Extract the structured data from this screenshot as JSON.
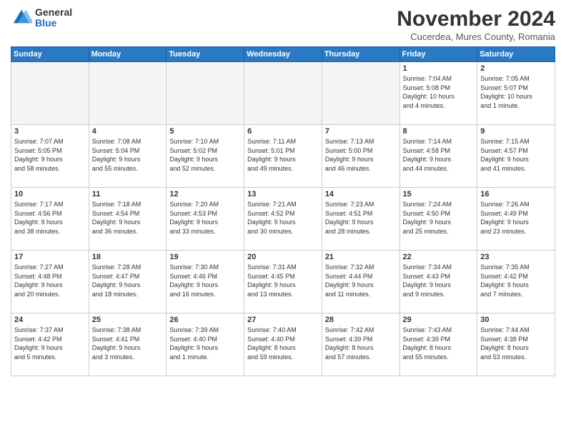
{
  "logo": {
    "general": "General",
    "blue": "Blue"
  },
  "header": {
    "title": "November 2024",
    "subtitle": "Cucerdea, Mures County, Romania"
  },
  "weekdays": [
    "Sunday",
    "Monday",
    "Tuesday",
    "Wednesday",
    "Thursday",
    "Friday",
    "Saturday"
  ],
  "rows": [
    [
      {
        "day": "",
        "info": "",
        "empty": true
      },
      {
        "day": "",
        "info": "",
        "empty": true
      },
      {
        "day": "",
        "info": "",
        "empty": true
      },
      {
        "day": "",
        "info": "",
        "empty": true
      },
      {
        "day": "",
        "info": "",
        "empty": true
      },
      {
        "day": "1",
        "info": "Sunrise: 7:04 AM\nSunset: 5:08 PM\nDaylight: 10 hours\nand 4 minutes.",
        "empty": false
      },
      {
        "day": "2",
        "info": "Sunrise: 7:05 AM\nSunset: 5:07 PM\nDaylight: 10 hours\nand 1 minute.",
        "empty": false
      }
    ],
    [
      {
        "day": "3",
        "info": "Sunrise: 7:07 AM\nSunset: 5:05 PM\nDaylight: 9 hours\nand 58 minutes.",
        "empty": false
      },
      {
        "day": "4",
        "info": "Sunrise: 7:08 AM\nSunset: 5:04 PM\nDaylight: 9 hours\nand 55 minutes.",
        "empty": false
      },
      {
        "day": "5",
        "info": "Sunrise: 7:10 AM\nSunset: 5:02 PM\nDaylight: 9 hours\nand 52 minutes.",
        "empty": false
      },
      {
        "day": "6",
        "info": "Sunrise: 7:11 AM\nSunset: 5:01 PM\nDaylight: 9 hours\nand 49 minutes.",
        "empty": false
      },
      {
        "day": "7",
        "info": "Sunrise: 7:13 AM\nSunset: 5:00 PM\nDaylight: 9 hours\nand 46 minutes.",
        "empty": false
      },
      {
        "day": "8",
        "info": "Sunrise: 7:14 AM\nSunset: 4:58 PM\nDaylight: 9 hours\nand 44 minutes.",
        "empty": false
      },
      {
        "day": "9",
        "info": "Sunrise: 7:15 AM\nSunset: 4:57 PM\nDaylight: 9 hours\nand 41 minutes.",
        "empty": false
      }
    ],
    [
      {
        "day": "10",
        "info": "Sunrise: 7:17 AM\nSunset: 4:56 PM\nDaylight: 9 hours\nand 38 minutes.",
        "empty": false
      },
      {
        "day": "11",
        "info": "Sunrise: 7:18 AM\nSunset: 4:54 PM\nDaylight: 9 hours\nand 36 minutes.",
        "empty": false
      },
      {
        "day": "12",
        "info": "Sunrise: 7:20 AM\nSunset: 4:53 PM\nDaylight: 9 hours\nand 33 minutes.",
        "empty": false
      },
      {
        "day": "13",
        "info": "Sunrise: 7:21 AM\nSunset: 4:52 PM\nDaylight: 9 hours\nand 30 minutes.",
        "empty": false
      },
      {
        "day": "14",
        "info": "Sunrise: 7:23 AM\nSunset: 4:51 PM\nDaylight: 9 hours\nand 28 minutes.",
        "empty": false
      },
      {
        "day": "15",
        "info": "Sunrise: 7:24 AM\nSunset: 4:50 PM\nDaylight: 9 hours\nand 25 minutes.",
        "empty": false
      },
      {
        "day": "16",
        "info": "Sunrise: 7:26 AM\nSunset: 4:49 PM\nDaylight: 9 hours\nand 23 minutes.",
        "empty": false
      }
    ],
    [
      {
        "day": "17",
        "info": "Sunrise: 7:27 AM\nSunset: 4:48 PM\nDaylight: 9 hours\nand 20 minutes.",
        "empty": false
      },
      {
        "day": "18",
        "info": "Sunrise: 7:28 AM\nSunset: 4:47 PM\nDaylight: 9 hours\nand 18 minutes.",
        "empty": false
      },
      {
        "day": "19",
        "info": "Sunrise: 7:30 AM\nSunset: 4:46 PM\nDaylight: 9 hours\nand 16 minutes.",
        "empty": false
      },
      {
        "day": "20",
        "info": "Sunrise: 7:31 AM\nSunset: 4:45 PM\nDaylight: 9 hours\nand 13 minutes.",
        "empty": false
      },
      {
        "day": "21",
        "info": "Sunrise: 7:32 AM\nSunset: 4:44 PM\nDaylight: 9 hours\nand 11 minutes.",
        "empty": false
      },
      {
        "day": "22",
        "info": "Sunrise: 7:34 AM\nSunset: 4:43 PM\nDaylight: 9 hours\nand 9 minutes.",
        "empty": false
      },
      {
        "day": "23",
        "info": "Sunrise: 7:35 AM\nSunset: 4:42 PM\nDaylight: 9 hours\nand 7 minutes.",
        "empty": false
      }
    ],
    [
      {
        "day": "24",
        "info": "Sunrise: 7:37 AM\nSunset: 4:42 PM\nDaylight: 9 hours\nand 5 minutes.",
        "empty": false
      },
      {
        "day": "25",
        "info": "Sunrise: 7:38 AM\nSunset: 4:41 PM\nDaylight: 9 hours\nand 3 minutes.",
        "empty": false
      },
      {
        "day": "26",
        "info": "Sunrise: 7:39 AM\nSunset: 4:40 PM\nDaylight: 9 hours\nand 1 minute.",
        "empty": false
      },
      {
        "day": "27",
        "info": "Sunrise: 7:40 AM\nSunset: 4:40 PM\nDaylight: 8 hours\nand 59 minutes.",
        "empty": false
      },
      {
        "day": "28",
        "info": "Sunrise: 7:42 AM\nSunset: 4:39 PM\nDaylight: 8 hours\nand 57 minutes.",
        "empty": false
      },
      {
        "day": "29",
        "info": "Sunrise: 7:43 AM\nSunset: 4:39 PM\nDaylight: 8 hours\nand 55 minutes.",
        "empty": false
      },
      {
        "day": "30",
        "info": "Sunrise: 7:44 AM\nSunset: 4:38 PM\nDaylight: 8 hours\nand 53 minutes.",
        "empty": false
      }
    ]
  ]
}
